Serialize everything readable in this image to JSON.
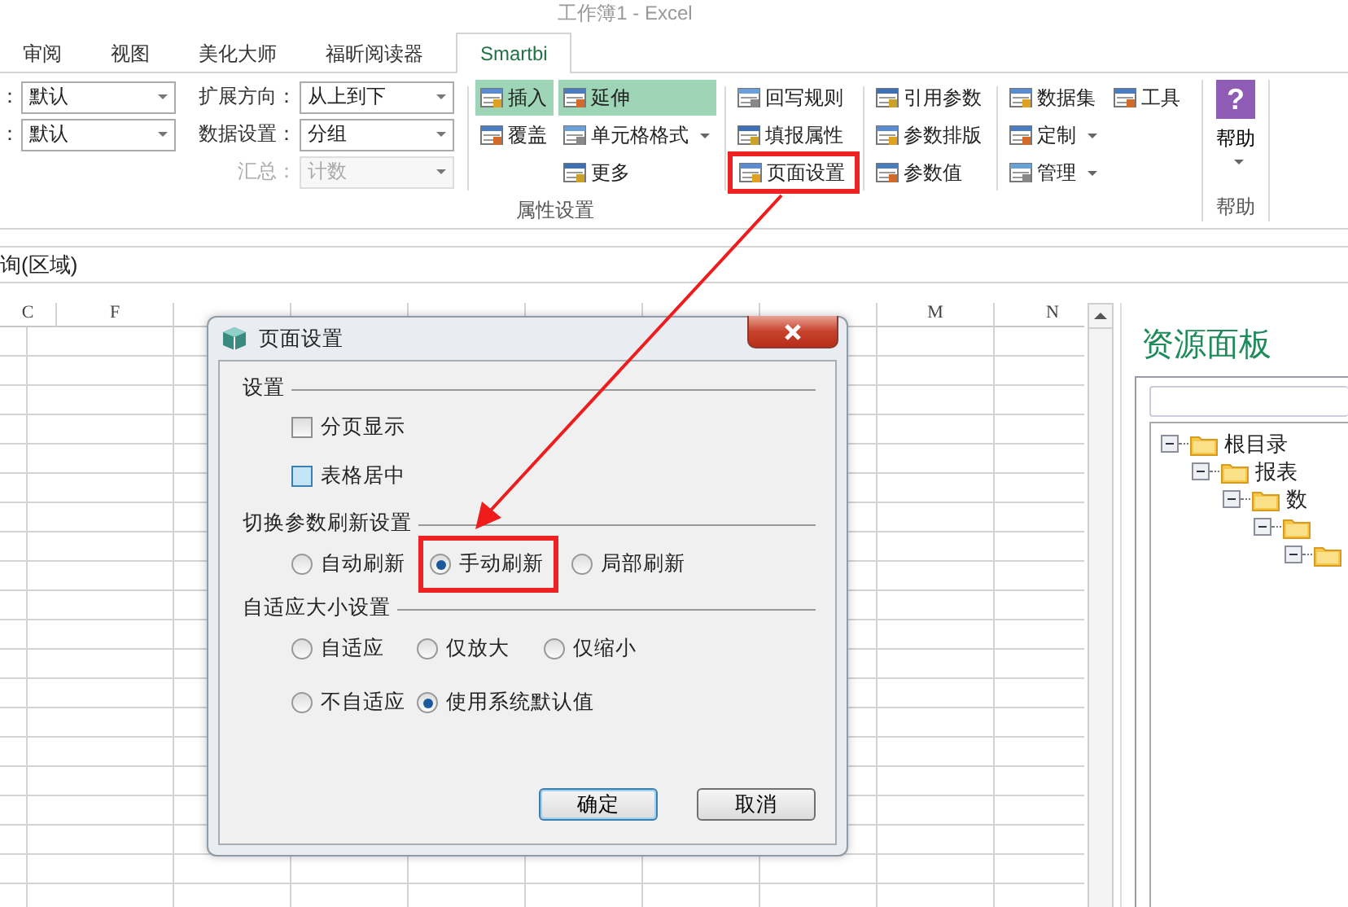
{
  "window": {
    "title": "工作簿1 - Excel"
  },
  "tabs": [
    {
      "label": "审阅",
      "selected": false
    },
    {
      "label": "视图",
      "selected": false
    },
    {
      "label": "美化大师",
      "selected": false
    },
    {
      "label": "福昕阅读器",
      "selected": false
    },
    {
      "label": "Smartbi",
      "selected": true
    }
  ],
  "ribbon": {
    "field_columns": [
      {
        "fields": [
          {
            "label": "：",
            "value": "默认",
            "disabled": false
          },
          {
            "label": "：",
            "value": "默认",
            "disabled": false
          }
        ]
      },
      {
        "fields": [
          {
            "label": "扩展方向：",
            "value": "从上到下",
            "disabled": false
          },
          {
            "label": "数据设置：",
            "value": "分组",
            "disabled": false
          },
          {
            "label": "汇总：",
            "value": "计数",
            "disabled": true
          }
        ]
      }
    ],
    "button_columns": [
      {
        "buttons": [
          {
            "label": "插入",
            "highlighted": true,
            "dropdown": false,
            "annotated": false
          },
          {
            "label": "覆盖",
            "highlighted": false,
            "dropdown": false,
            "annotated": false
          }
        ]
      },
      {
        "buttons": [
          {
            "label": "延伸",
            "highlighted": true,
            "dropdown": false,
            "annotated": false
          },
          {
            "label": "单元格格式",
            "highlighted": false,
            "dropdown": true,
            "annotated": false
          },
          {
            "label": "更多",
            "highlighted": false,
            "dropdown": false,
            "annotated": false
          }
        ]
      },
      {
        "buttons": [
          {
            "label": "回写规则",
            "highlighted": false,
            "dropdown": false,
            "annotated": false
          },
          {
            "label": "填报属性",
            "highlighted": false,
            "dropdown": false,
            "annotated": false
          },
          {
            "label": "页面设置",
            "highlighted": false,
            "dropdown": false,
            "annotated": true
          }
        ]
      },
      {
        "buttons": [
          {
            "label": "引用参数",
            "highlighted": false,
            "dropdown": false,
            "annotated": false
          },
          {
            "label": "参数排版",
            "highlighted": false,
            "dropdown": false,
            "annotated": false
          },
          {
            "label": "参数值",
            "highlighted": false,
            "dropdown": false,
            "annotated": false
          }
        ]
      },
      {
        "buttons": [
          {
            "label": "数据集",
            "highlighted": false,
            "dropdown": false,
            "annotated": false
          },
          {
            "label": "定制",
            "highlighted": false,
            "dropdown": true,
            "annotated": false
          },
          {
            "label": "管理",
            "highlighted": false,
            "dropdown": true,
            "annotated": false
          }
        ]
      },
      {
        "buttons": [
          {
            "label": "工具",
            "highlighted": false,
            "dropdown": false,
            "annotated": false
          }
        ]
      }
    ],
    "group_label": "属性设置",
    "help": {
      "icon": "?",
      "label": "帮助",
      "group_label": "帮助"
    }
  },
  "name_box": "询(区域)",
  "sheet": {
    "columns": [
      {
        "label": "C"
      },
      {
        "label": "F"
      },
      {},
      {},
      {},
      {},
      {},
      {},
      {
        "label": "M"
      },
      {
        "label": "N"
      }
    ]
  },
  "resource_panel": {
    "title": "资源面板",
    "tree": [
      {
        "label": "根目录",
        "expanded": true,
        "children": [
          {
            "label": "报表",
            "expanded": true,
            "children": [
              {
                "label": "数",
                "expanded": true,
                "children": [
                  {
                    "expanded": true,
                    "children": [
                      {
                        "expanded": true
                      }
                    ]
                  }
                ]
              }
            ]
          }
        ]
      }
    ]
  },
  "dialog": {
    "title": "页面设置",
    "sections": [
      {
        "title": "设置",
        "kind": "checkboxes",
        "options": [
          {
            "label": "分页显示",
            "checked": false,
            "focused": false
          },
          {
            "label": "表格居中",
            "checked": false,
            "focused": true
          }
        ]
      },
      {
        "title": "切换参数刷新设置",
        "kind": "radios",
        "options": [
          {
            "label": "自动刷新",
            "selected": false,
            "annotated": false
          },
          {
            "label": "手动刷新",
            "selected": true,
            "annotated": true
          },
          {
            "label": "局部刷新",
            "selected": false,
            "annotated": false
          }
        ]
      },
      {
        "title": "自适应大小设置",
        "kind": "radio-grid",
        "options": [
          {
            "label": "自适应",
            "selected": false,
            "annotated": false
          },
          {
            "label": "仅放大",
            "selected": false,
            "annotated": false
          },
          {
            "label": "仅缩小",
            "selected": false,
            "annotated": false
          },
          {
            "label": "不自适应",
            "selected": false,
            "annotated": false
          },
          {
            "label": "使用系统默认值",
            "selected": true,
            "annotated": false
          }
        ]
      }
    ],
    "buttons": [
      {
        "label": "确定",
        "default": true
      },
      {
        "label": "取消",
        "default": false
      }
    ]
  }
}
